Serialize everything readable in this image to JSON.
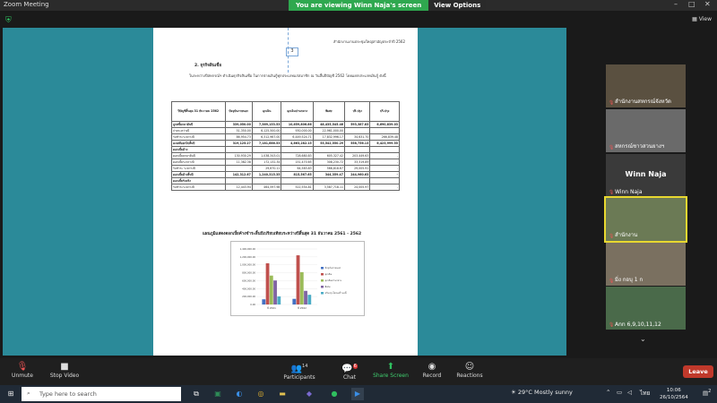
{
  "window": {
    "title": "Zoom Meeting"
  },
  "banner": {
    "message": "You are viewing Winn Naja's screen",
    "options_label": "View Options"
  },
  "view": {
    "label": "View"
  },
  "document": {
    "header": "สำนักงานงานประชุมใหญ่สามัญประจำปี 2562",
    "page_number": "3",
    "section": "2. ธุรกิจสินเชื่อ",
    "paragraph": "ในระหว่างปีสหกรณ์ฯ ดำเนินธุรกิจสินเชื่อ ในการจ่ายเงินกู้ทุกประเภทแก่สมาชิก ณ วันสิ้นปีบัญชี 2562 โดยแยกประเภทเงินกู้ ดังนี้",
    "table": {
      "headers": [
        "ปีบัญชีสิ้นสุด 31 ธันวาคม 2562",
        "ปัจจุบันภายนอก",
        "ฉุกเฉิน",
        "ฉุกเฉินปานกลาง",
        "พิเศษ",
        "ปริ.ปรุง",
        "ปริ.ปรุง"
      ],
      "rows": [
        {
          "bold": true,
          "cells": [
            "ลูกหนี้ยกมาต้นปี",
            "339,050.00",
            "7,369,153.53",
            "10,659,806.86",
            "48,435,545.46",
            "593,387.83",
            "6,690,839.03"
          ]
        },
        {
          "bold": false,
          "cells": [
            "จ่ายระหว่างปี",
            "51,350.00",
            "6,125,500.00",
            "930,000.00",
            "22,961,000.00",
            "",
            ""
          ]
        },
        {
          "bold": false,
          "cells": [
            "รับชำระระหว่างปี",
            "86,954.73",
            "6,312,967.00",
            "6,449,524.71",
            "17,832,996.17",
            "34,631.70",
            "266,839.48"
          ]
        },
        {
          "bold": true,
          "cells": [
            "คงเหลือยกไปสิ้นปี",
            "319,125.27",
            "7,181,686.53",
            "4,663,282.15",
            "53,542,550.29",
            "558,756.13",
            "6,423,999.55"
          ]
        },
        {
          "bold": true,
          "cells": [
            "ดอกเบี้ยค้าง",
            "",
            "",
            "",
            "",
            "",
            ""
          ]
        },
        {
          "bold": false,
          "cells": [
            "ดอกเบี้ยยกมาต้นปี",
            "130,930.29",
            "1,038,343.01",
            "728,680.83",
            "605,327.42",
            "203,449.63",
            "-"
          ]
        },
        {
          "bold": false,
          "cells": [
            "ดอกเบี้ยระหว่างปี",
            "11,382.38",
            "172,132.34",
            "151,470.65",
            "308,230.72",
            "33,319.89",
            "-"
          ]
        },
        {
          "bold": false,
          "cells": [
            "รับชำระ ระหว่างปี",
            "-",
            "29,670.11",
            "64,583.83",
            "568,818.67",
            "29,005.91",
            "-"
          ]
        },
        {
          "bold": true,
          "cells": [
            "ดอกเบี้ยค้างสิ้นปี",
            "142,312.67",
            "1,240,315.35",
            "815,567.65",
            "344,359.47",
            "244,960.63",
            "-"
          ]
        },
        {
          "bold": true,
          "cells": [
            "ดอกเบี้ยรับจริง",
            "",
            "",
            "",
            "",
            "",
            ""
          ]
        },
        {
          "bold": false,
          "cells": [
            "รับชำระระหว่างปี",
            "12,443.94",
            "464,597.98",
            "522,554.81",
            "3,587,718.11",
            "24,005.97",
            "-"
          ]
        }
      ]
    },
    "chart_caption": "แผนภูมิแสดงดอกเบี้ยค้างชำระสิ้นปีเปรียบเทียบระหว่างปีสิ้นสุด 31 ธันวาคม 2561 - 2562"
  },
  "chart_data": {
    "type": "bar",
    "categories": [
      "ปี 2561",
      "ปี 2562"
    ],
    "ylim": [
      0,
      1400000
    ],
    "yticks": [
      "1,400,000.00",
      "1,200,000.00",
      "1,000,000.00",
      "800,000.00",
      "600,000.00",
      "400,000.00",
      "200,000.00",
      "0.00"
    ],
    "series": [
      {
        "name": "ปัจจุบันภายนอก",
        "color": "#4472c4",
        "values": [
          130930,
          142313
        ]
      },
      {
        "name": "ฉุกเฉิน",
        "color": "#c0504d",
        "values": [
          1038343,
          1240315
        ]
      },
      {
        "name": "ฉุกเฉินปานกลาง",
        "color": "#9bbb59",
        "values": [
          728681,
          815568
        ]
      },
      {
        "name": "พิเศษ",
        "color": "#8064a2",
        "values": [
          605327,
          344359
        ]
      },
      {
        "name": "ปรับปรุงโครงสร้างหนี้",
        "color": "#4bacc6",
        "values": [
          203450,
          244961
        ]
      }
    ]
  },
  "participants_tiles": [
    {
      "name": "สำนักงานสหกรณ์จังหวัด",
      "color": "#5a5040"
    },
    {
      "name": "สหกรณ์ชาวสวนยางฯ",
      "color": "#6a6a6a"
    },
    {
      "name": "Winn Naja",
      "color": "#3a3a3a",
      "big": "Winn Naja"
    },
    {
      "name": "สำนักงาน",
      "color": "#6b7a55"
    },
    {
      "name": "มิ่ง กอบุ 1 ก",
      "color": "#7a7060"
    },
    {
      "name": "Ann 6,9,10,11,12",
      "color": "#4a6a4a"
    }
  ],
  "toolbar": {
    "unmute": "Unmute",
    "stop_video": "Stop Video",
    "participants": "Participants",
    "participants_count": "14",
    "chat": "Chat",
    "chat_badge": "6",
    "share_screen": "Share Screen",
    "record": "Record",
    "reactions": "Reactions",
    "leave": "Leave"
  },
  "taskbar": {
    "search_placeholder": "Type here to search",
    "weather": "29°C  Mostly sunny",
    "lang": "ไทย",
    "time": "10:06",
    "date": "26/10/2564",
    "notif_count": "2"
  }
}
